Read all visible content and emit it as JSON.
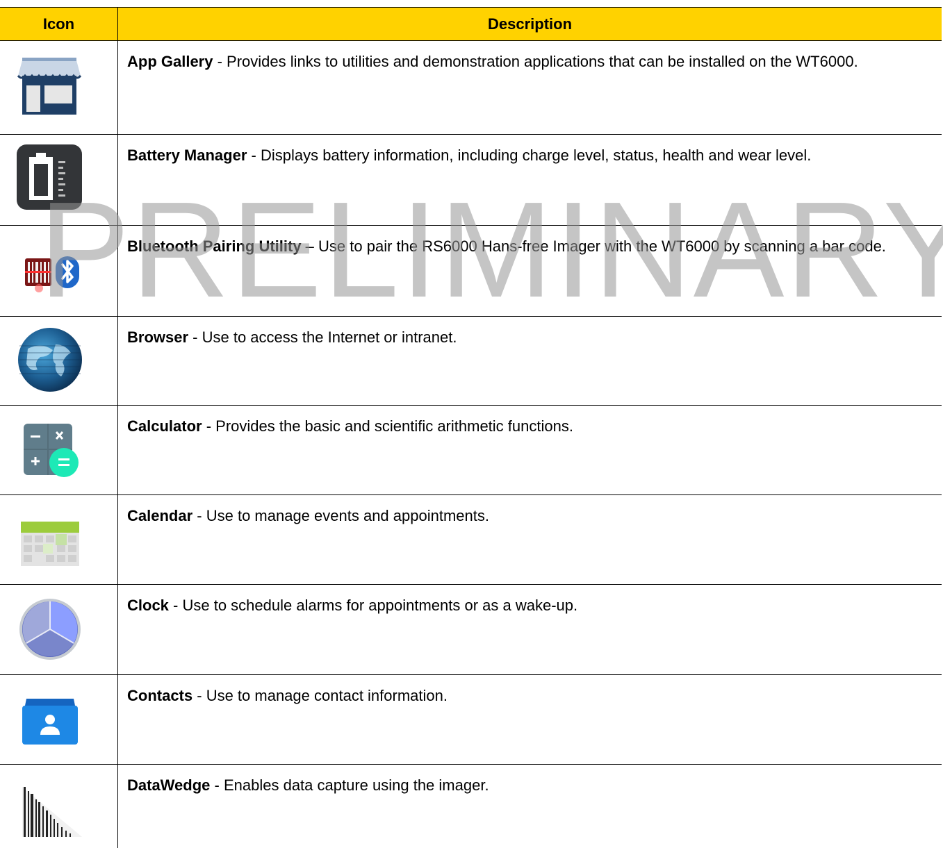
{
  "table": {
    "headers": {
      "icon": "Icon",
      "description": "Description"
    },
    "rows": [
      {
        "name": "App Gallery",
        "sep": " - ",
        "text": "Provides links to utilities and demonstration applications that can be installed on the WT6000.",
        "icon": "store-icon"
      },
      {
        "name": "Battery Manager",
        "sep": " - ",
        "text": "Displays battery information, including charge level, status, health and wear level.",
        "icon": "battery-icon"
      },
      {
        "name": "Bluetooth Pairing Utility",
        "sep": " – ",
        "text": "Use to pair the RS6000 Hans-free Imager with the WT6000 by scanning a bar code.",
        "icon": "bluetooth-pairing-icon"
      },
      {
        "name": "Browser",
        "sep": " - ",
        "text": "Use to access the Internet or intranet.",
        "icon": "globe-icon"
      },
      {
        "name": "Calculator",
        "sep": " - ",
        "text": "Provides the basic and scientific arithmetic functions.",
        "icon": "calculator-icon"
      },
      {
        "name": "Calendar",
        "sep": " - ",
        "text": "Use to manage events and appointments.",
        "icon": "calendar-icon"
      },
      {
        "name": "Clock",
        "sep": " - ",
        "text": "Use to schedule alarms for appointments or as a wake-up.",
        "icon": "clock-icon"
      },
      {
        "name": "Contacts",
        "sep": " - ",
        "text": "Use to manage contact information.",
        "icon": "contacts-icon"
      },
      {
        "name": "DataWedge",
        "sep": " - ",
        "text": "Enables data capture using the imager.",
        "icon": "barcode-icon"
      }
    ]
  },
  "watermark": "PRELIMINARY",
  "colors": {
    "header_bg": "#FFD200",
    "watermark": "#969696"
  }
}
